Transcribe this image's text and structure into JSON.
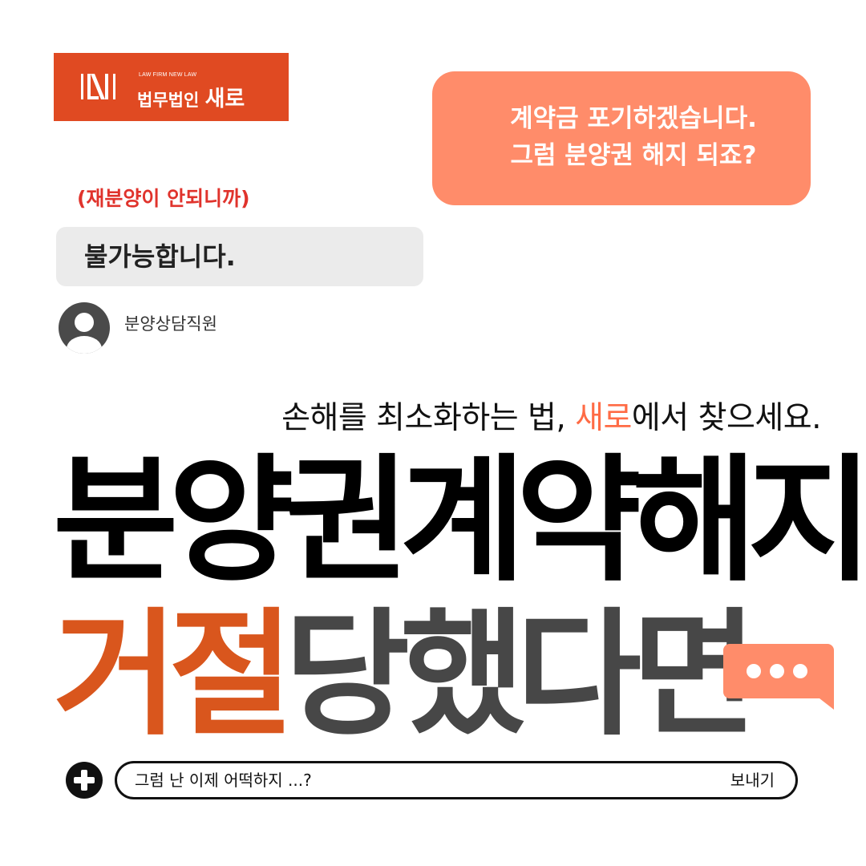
{
  "logo": {
    "subtitle": "LAW FIRM NEW LAW",
    "name_prefix": "법무법인",
    "name_main": "새로",
    "color": "#e04a22"
  },
  "chat": {
    "customer_message_line1": "계약금 포기하겠습니다.",
    "customer_message_line2": "그럼 분양권 해지 되죠?",
    "aside_note": "(재분양이 안되니까)",
    "agent_reply": "불가능합니다.",
    "agent_name": "분양상담직원",
    "agent_avatar_icon": "user-avatar-icon"
  },
  "tagline": {
    "part1": "손해를 최소화하는 법, ",
    "accent": "새로",
    "part2": "에서 찾으세요."
  },
  "headline": {
    "line1": "분양권계약해지",
    "line2_accent": "거절",
    "line2_rest": "당했다면"
  },
  "typing_indicator_icon": "typing-dots-icon",
  "composer": {
    "add_icon": "plus-icon",
    "input_value": "그럼 난 이제 어떡하지 ...?",
    "send_label": "보내기"
  },
  "colors": {
    "accent_orange": "#ff8c6a",
    "headline_orange": "#d9561d",
    "aside_red": "#e0332c",
    "headline_grey": "#474747"
  }
}
